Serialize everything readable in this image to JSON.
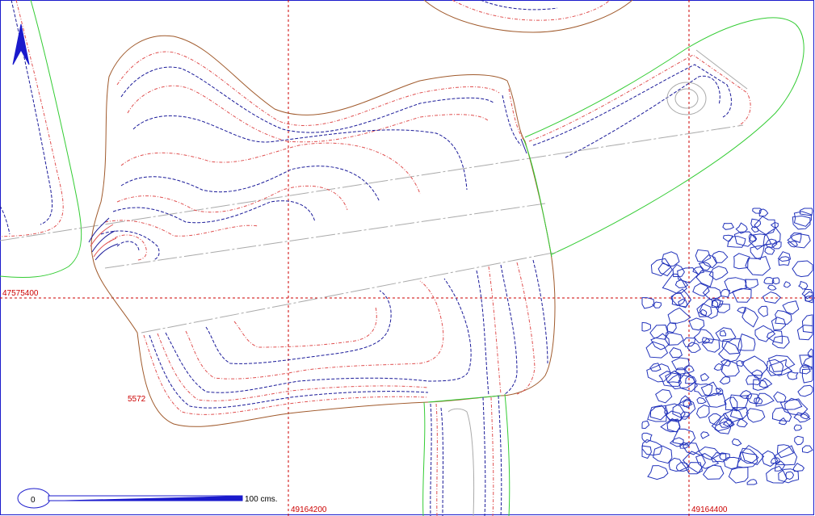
{
  "map": {
    "grid_labels": {
      "northing": "47575400",
      "easting_1": "49164200",
      "easting_2": "49164400"
    },
    "spot_label": "5572",
    "scale_bar": {
      "start_label": "0",
      "end_label": "100 cms."
    },
    "colors": {
      "grid": "#cc0000",
      "outline": "#a05a2c",
      "contour_blue": "#1a1a99",
      "contour_red": "#e05050",
      "green_boundary": "#33cc33",
      "stones": "#2233bb",
      "gray_line": "#aaaaaa",
      "frame": "#1a1acc"
    },
    "north_arrow_icon": "north-arrow-icon"
  }
}
